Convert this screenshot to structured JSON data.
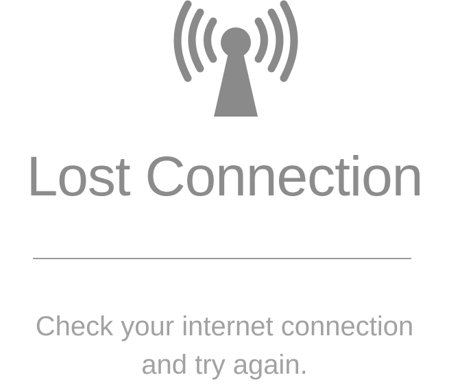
{
  "icon": {
    "name": "antenna-broadcast-icon",
    "color": "#8a8a8a"
  },
  "title": "Lost Connection",
  "message": {
    "line1": "Check your internet connection",
    "line2": "and try again."
  },
  "colors": {
    "title": "#8c8c8c",
    "message": "#a2a2a2",
    "divider": "#9a9a9a",
    "background": "#ffffff"
  }
}
